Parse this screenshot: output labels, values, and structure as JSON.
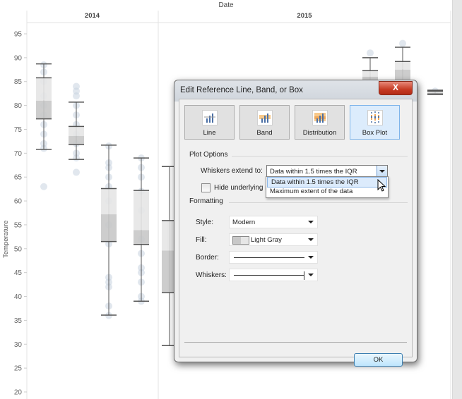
{
  "chart_data": {
    "type": "box",
    "title": "",
    "column_header": "Date",
    "columns": [
      "2014",
      "2015"
    ],
    "ylabel": "Temperature",
    "ylim": [
      20,
      97
    ],
    "yticks": [
      95,
      90,
      85,
      80,
      75,
      70,
      65,
      60,
      55,
      50,
      45,
      40,
      35,
      30,
      25,
      20
    ],
    "grid": false,
    "boxes": [
      {
        "column": "2014",
        "slot": 0,
        "whisker_high": 88.7,
        "q3": 85.8,
        "median": 81.0,
        "q1": 77.2,
        "whisker_low": 70.8,
        "points": [
          88.5,
          87,
          85,
          82,
          80,
          78,
          76,
          74,
          72,
          71,
          63
        ]
      },
      {
        "column": "2014",
        "slot": 1,
        "whisker_high": 80.7,
        "q3": 75.6,
        "median": 73.6,
        "q1": 71.8,
        "whisker_low": 68.7,
        "points": [
          84,
          83,
          82,
          80,
          78,
          76,
          74,
          72,
          70,
          69,
          66
        ]
      },
      {
        "column": "2014",
        "slot": 2,
        "whisker_high": 71.7,
        "q3": 62.6,
        "median": 57.2,
        "q1": 51.5,
        "whisker_low": 36.1,
        "points": [
          71.5,
          68,
          67,
          65,
          63,
          60,
          55,
          51,
          44,
          43,
          42,
          38,
          36
        ]
      },
      {
        "column": "2014",
        "slot": 3,
        "whisker_high": 69.0,
        "q3": 62.2,
        "median": 53.9,
        "q1": 50.9,
        "whisker_low": 39.0,
        "points": [
          69,
          67,
          65,
          62,
          58,
          52,
          49,
          46,
          45,
          43,
          40,
          39
        ]
      },
      {
        "column": "2015",
        "slot": 0,
        "whisker_high": 67.2,
        "q3": 55.9,
        "median": 49.6,
        "q1": 40.8,
        "whisker_low": 29.7,
        "points": []
      },
      {
        "column": "2015",
        "slot": 6,
        "whisker_high": 90.0,
        "q3": 87.3,
        "median": 86.0,
        "q1": 84.5,
        "whisker_low": 83.0,
        "points": [
          91
        ]
      },
      {
        "column": "2015",
        "slot": 7,
        "whisker_high": 92.2,
        "q3": 89.2,
        "median": 87.5,
        "q1": 85.0,
        "whisker_low": 83.0,
        "points": [
          93
        ]
      },
      {
        "column": "2015",
        "slot": 8,
        "whisker_high": 83.2,
        "q3": 83.0,
        "median": 82.7,
        "q1": 82.4,
        "whisker_low": 82.3,
        "points": [
          83
        ]
      }
    ]
  },
  "colors": {
    "box_light": "#e6e6e6",
    "box_dark": "#c8c8c8",
    "whisker": "#555555",
    "points": "#c9d3e0",
    "selected_accent": "#7eb4ea",
    "close_red": "#c63b24"
  },
  "dialog": {
    "title": "Edit Reference Line, Band, or Box",
    "close_label": "X",
    "types": [
      {
        "label": "Line",
        "icon": "reference-line-icon",
        "selected": false
      },
      {
        "label": "Band",
        "icon": "reference-band-icon",
        "selected": false
      },
      {
        "label": "Distribution",
        "icon": "distribution-icon",
        "selected": false
      },
      {
        "label": "Box Plot",
        "icon": "box-plot-icon",
        "selected": true
      }
    ],
    "plot_options_label": "Plot Options",
    "whiskers_label": "Whiskers extend to:",
    "whiskers_value": "Data within 1.5 times the IQR",
    "whiskers_options": [
      "Data within 1.5 times the IQR",
      "Maximum extent of the data"
    ],
    "hide_marks_label": "Hide underlying m",
    "hide_marks_checked": false,
    "formatting_label": "Formatting",
    "style_label": "Style:",
    "style_value": "Modern",
    "fill_label": "Fill:",
    "fill_value": "Light Gray",
    "border_label": "Border:",
    "whiskers_fmt_label": "Whiskers:",
    "ok_label": "OK"
  }
}
